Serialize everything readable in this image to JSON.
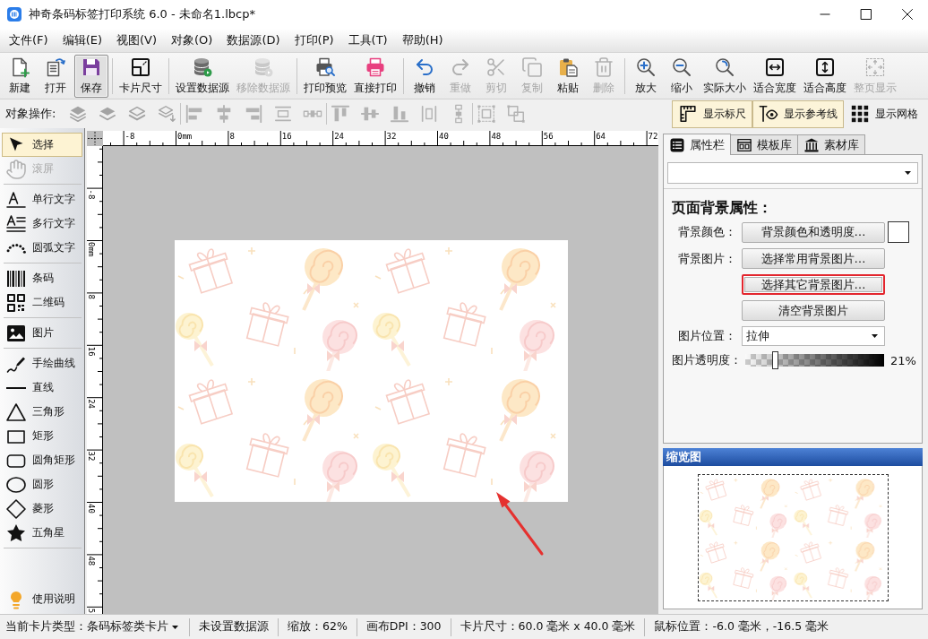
{
  "window": {
    "title": "神奇条码标签打印系统 6.0 - 未命名1.lbcp*"
  },
  "menu": [
    "文件(F)",
    "编辑(E)",
    "视图(V)",
    "对象(O)",
    "数据源(D)",
    "打印(P)",
    "工具(T)",
    "帮助(H)"
  ],
  "toolbar": [
    [
      {
        "kind": "new",
        "label": "新建",
        "disabled": false,
        "highlighted": false
      },
      {
        "kind": "open",
        "label": "打开",
        "disabled": false,
        "highlighted": false
      },
      {
        "kind": "save",
        "label": "保存",
        "disabled": false,
        "highlighted": true
      }
    ],
    [
      {
        "kind": "card_size",
        "label": "卡片尺寸",
        "disabled": false,
        "highlighted": false
      }
    ],
    [
      {
        "kind": "datasource_set",
        "label": "设置数据源",
        "disabled": false,
        "highlighted": false
      },
      {
        "kind": "datasource_remove",
        "label": "移除数据源",
        "disabled": true,
        "highlighted": false
      }
    ],
    [
      {
        "kind": "print_preview",
        "label": "打印预览",
        "disabled": false,
        "highlighted": false
      },
      {
        "kind": "print",
        "label": "直接打印",
        "disabled": false,
        "highlighted": false
      }
    ],
    [
      {
        "kind": "undo",
        "label": "撤销",
        "disabled": false,
        "highlighted": false
      },
      {
        "kind": "redo",
        "label": "重做",
        "disabled": true,
        "highlighted": false
      },
      {
        "kind": "cut",
        "label": "剪切",
        "disabled": true,
        "highlighted": false
      },
      {
        "kind": "copy",
        "label": "复制",
        "disabled": true,
        "highlighted": false
      },
      {
        "kind": "paste",
        "label": "粘贴",
        "disabled": false,
        "highlighted": false
      },
      {
        "kind": "delete",
        "label": "删除",
        "disabled": true,
        "highlighted": false
      }
    ],
    [
      {
        "kind": "zoom_in",
        "label": "放大",
        "disabled": false,
        "highlighted": false
      },
      {
        "kind": "zoom_out",
        "label": "缩小",
        "disabled": false,
        "highlighted": false
      },
      {
        "kind": "actual_size",
        "label": "实际大小",
        "disabled": false,
        "highlighted": false
      },
      {
        "kind": "fit_width",
        "label": "适合宽度",
        "disabled": false,
        "highlighted": false
      },
      {
        "kind": "fit_height",
        "label": "适合高度",
        "disabled": false,
        "highlighted": false
      },
      {
        "kind": "fit_page",
        "label": "整页显示",
        "disabled": true,
        "highlighted": false
      }
    ]
  ],
  "object_bar": {
    "label": "对象操作:",
    "tools": [
      [
        {
          "kind": "layer_top",
          "disabled": true
        },
        {
          "kind": "layer_up",
          "disabled": true
        },
        {
          "kind": "layer_down",
          "disabled": true
        },
        {
          "kind": "layer_bottom",
          "disabled": true
        }
      ],
      [
        {
          "kind": "align_left",
          "disabled": true
        },
        {
          "kind": "align_center_h",
          "disabled": true
        },
        {
          "kind": "align_right",
          "disabled": true
        },
        {
          "kind": "space_h",
          "disabled": true
        },
        {
          "kind": "distribute_h",
          "disabled": true
        }
      ],
      [
        {
          "kind": "align_top",
          "disabled": true
        },
        {
          "kind": "align_center_v",
          "disabled": true
        },
        {
          "kind": "align_bottom",
          "disabled": true
        },
        {
          "kind": "space_v",
          "disabled": true
        },
        {
          "kind": "distribute_v",
          "disabled": true
        }
      ],
      [
        {
          "kind": "group",
          "disabled": true
        },
        {
          "kind": "ungroup",
          "disabled": true
        }
      ]
    ]
  },
  "view_toggles": [
    {
      "kind": "ruler",
      "label": "显示标尺",
      "on": true
    },
    {
      "kind": "guides",
      "label": "显示参考线",
      "on": true
    },
    {
      "kind": "grid",
      "label": "显示网格",
      "on": false
    }
  ],
  "tools_panel": [
    [
      {
        "kind": "select",
        "label": "选择",
        "selected": true,
        "disabled": false
      },
      {
        "kind": "scroll",
        "label": "滚屏",
        "selected": false,
        "disabled": true
      }
    ],
    [
      {
        "kind": "text_single",
        "label": "单行文字",
        "selected": false,
        "disabled": false
      },
      {
        "kind": "text_multi",
        "label": "多行文字",
        "selected": false,
        "disabled": false
      },
      {
        "kind": "text_arc",
        "label": "圆弧文字",
        "selected": false,
        "disabled": false
      }
    ],
    [
      {
        "kind": "barcode",
        "label": "条码",
        "selected": false,
        "disabled": false
      },
      {
        "kind": "qrcode",
        "label": "二维码",
        "selected": false,
        "disabled": false
      }
    ],
    [
      {
        "kind": "image",
        "label": "图片",
        "selected": false,
        "disabled": false
      }
    ],
    [
      {
        "kind": "freehand",
        "label": "手绘曲线",
        "selected": false,
        "disabled": false
      },
      {
        "kind": "line",
        "label": "直线",
        "selected": false,
        "disabled": false
      },
      {
        "kind": "triangle",
        "label": "三角形",
        "selected": false,
        "disabled": false
      },
      {
        "kind": "rectangle",
        "label": "矩形",
        "selected": false,
        "disabled": false
      },
      {
        "kind": "rounded_rectangle",
        "label": "圆角矩形",
        "selected": false,
        "disabled": false
      },
      {
        "kind": "ellipse",
        "label": "圆形",
        "selected": false,
        "disabled": false
      },
      {
        "kind": "diamond",
        "label": "菱形",
        "selected": false,
        "disabled": false
      },
      {
        "kind": "star",
        "label": "五角星",
        "selected": false,
        "disabled": false
      }
    ],
    [
      {
        "kind": "help",
        "label": "使用说明",
        "selected": false,
        "disabled": false
      }
    ]
  ],
  "rulers": {
    "horizontal": [
      "-8",
      "0mm",
      "8",
      "16",
      "24",
      "32",
      "40",
      "48",
      "56",
      "64",
      "72"
    ],
    "vertical": [
      "-8",
      "0mm",
      "8",
      "16",
      "24",
      "32",
      "40",
      "48",
      "5"
    ]
  },
  "properties_panel": {
    "tabs": [
      {
        "kind": "properties",
        "label": "属性栏",
        "selected": true
      },
      {
        "kind": "templates",
        "label": "模板库",
        "selected": false
      },
      {
        "kind": "assets",
        "label": "素材库",
        "selected": false
      }
    ],
    "heading": "页面背景属性：",
    "rows": [
      {
        "kind": "button",
        "label": "背景颜色：",
        "button": "背景颜色和透明度…",
        "highlighted": false,
        "color": "#ffffff"
      },
      {
        "kind": "button",
        "label": "背景图片：",
        "button": "选择常用背景图片…",
        "highlighted": false
      },
      {
        "kind": "button",
        "button": "选择其它背景图片…",
        "highlighted": true
      },
      {
        "kind": "button",
        "button": "清空背景图片",
        "highlighted": false
      },
      {
        "kind": "select",
        "label": "图片位置：",
        "value": "拉伸"
      },
      {
        "kind": "slider",
        "label": "图片透明度：",
        "level": 0.21,
        "reading": "21%"
      }
    ]
  },
  "preview": {
    "title": "缩览图"
  },
  "status_bar": {
    "card_type_label": "当前卡片类型：",
    "card_type": "条码标签类卡片",
    "items": [
      "未设置数据源",
      "缩放：62%",
      "画布DPI：300",
      "卡片尺寸：60.0 毫米 x 40.0 毫米",
      "鼠标位置：-6.0 毫米，-16.5 毫米"
    ]
  }
}
